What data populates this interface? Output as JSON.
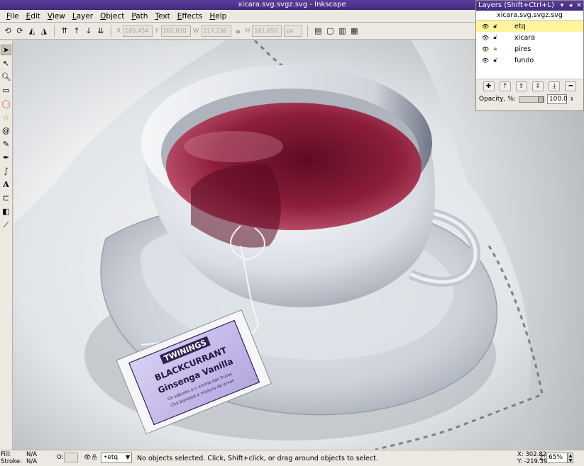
{
  "window": {
    "title": "xicara.svg.svgz.svg - Inkscape"
  },
  "menu": [
    "File",
    "Edit",
    "View",
    "Layer",
    "Object",
    "Path",
    "Text",
    "Effects",
    "Help"
  ],
  "toolbar": {
    "x": "185.454",
    "y": "202.820",
    "w": "217.236",
    "h": "161.650",
    "units": "px"
  },
  "tools": [
    "selector",
    "node",
    "zoom",
    "rectangle",
    "ellipse",
    "star",
    "spiral",
    "pencil",
    "pen",
    "calligraphy",
    "text",
    "connector",
    "gradient",
    "dropper"
  ],
  "layers_panel": {
    "title": "Layers (Shift+Ctrl+L)",
    "document": "xicara.svg.svgz.svg",
    "layers": [
      {
        "name": "etq",
        "selected": true,
        "locked": false
      },
      {
        "name": "xicara",
        "selected": false,
        "locked": false
      },
      {
        "name": "pires",
        "selected": false,
        "locked": true
      },
      {
        "name": "fundo",
        "selected": false,
        "locked": false
      }
    ],
    "opacity_label": "Opacity, %:",
    "opacity_value": "100.0"
  },
  "canvas": {
    "tag_brand": "TWININGS",
    "tag_title": "BLACKCURRANT",
    "tag_subtitle": "Ginsenga Vanilla",
    "tag_line1": "Os sabores e o aroma das frutas",
    "tag_line2": "Chá blended e mistura de ervas"
  },
  "statusbar": {
    "fill_label": "Fill:",
    "fill_value": "N/A",
    "stroke_label": "Stroke:",
    "stroke_value": "N/A",
    "o_label": "O:",
    "current_layer": "•etq",
    "message": "No objects selected. Click, Shift+click, or drag around objects to select.",
    "x_coord": "X: 302.82",
    "y_coord": "Y: -219.39",
    "z_label": "Z:",
    "zoom": "65%"
  }
}
